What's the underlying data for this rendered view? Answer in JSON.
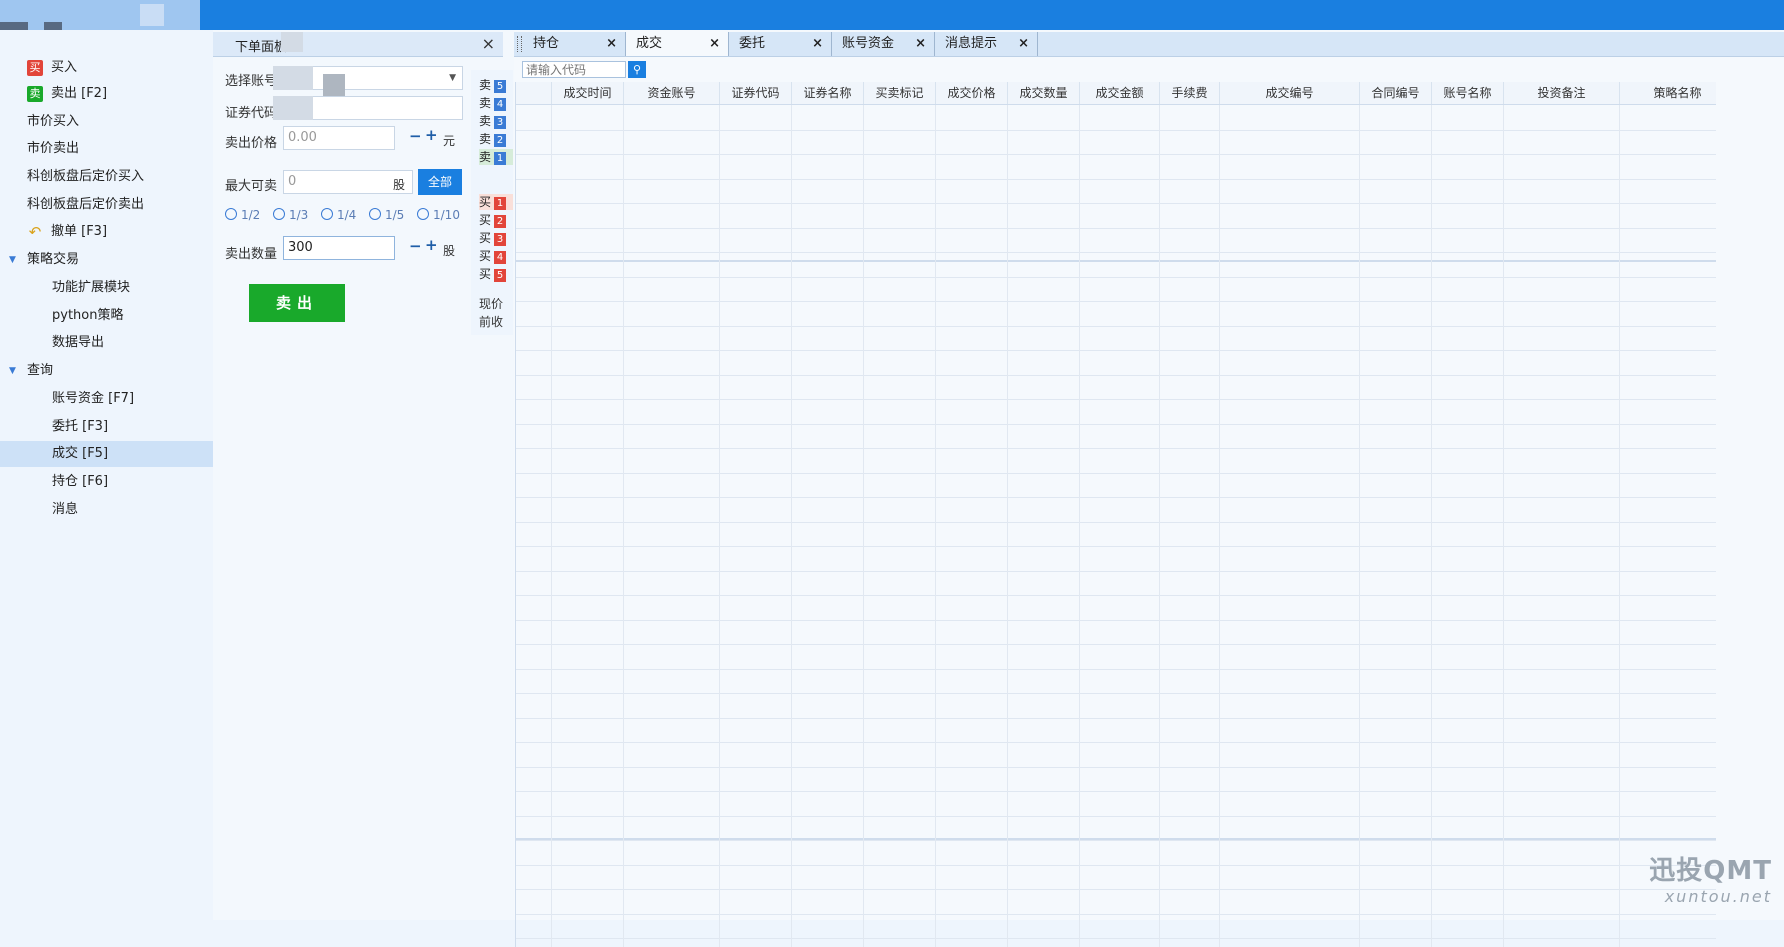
{
  "left_nav": {
    "items": [
      {
        "label": "买入",
        "icon": "buy-icon"
      },
      {
        "label": "卖出 [F2]",
        "icon": "sell-icon"
      },
      {
        "label": "市价买入"
      },
      {
        "label": "市价卖出"
      },
      {
        "label": "科创板盘后定价买入"
      },
      {
        "label": "科创板盘后定价卖出"
      },
      {
        "label": "撤单 [F3]",
        "icon": "undo-icon"
      },
      {
        "label": "策略交易",
        "group": true
      },
      {
        "label": "功能扩展模块"
      },
      {
        "label": "python策略"
      },
      {
        "label": "数据导出"
      },
      {
        "label": "查询",
        "group": true
      },
      {
        "label": "账号资金 [F7]"
      },
      {
        "label": "委托 [F3]"
      },
      {
        "label": "成交 [F5]",
        "selected": true
      },
      {
        "label": "持仓 [F6]"
      },
      {
        "label": "消息"
      }
    ],
    "sell_icon_text": "卖"
  },
  "order_panel": {
    "tab_title": "下单面板",
    "close": "×",
    "select_account_label": "选择账号",
    "security_code_label": "证券代码",
    "sell_price_label": "卖出价格",
    "sell_price_value": "0.00",
    "price_unit": "元",
    "max_sellable_label": "最大可卖",
    "max_sellable_value": "0",
    "shares_unit": "股",
    "all_button": "全部",
    "ratios": [
      "1/2",
      "1/3",
      "1/4",
      "1/5",
      "1/10"
    ],
    "sell_qty_label": "卖出数量",
    "sell_qty_value": "300",
    "minus": "−",
    "plus": "+",
    "sell_button": "卖出"
  },
  "depth": {
    "sell": [
      {
        "label": "卖",
        "num": "5"
      },
      {
        "label": "卖",
        "num": "4"
      },
      {
        "label": "卖",
        "num": "3"
      },
      {
        "label": "卖",
        "num": "2"
      },
      {
        "label": "卖",
        "num": "1"
      }
    ],
    "buy": [
      {
        "label": "买",
        "num": "1"
      },
      {
        "label": "买",
        "num": "2"
      },
      {
        "label": "买",
        "num": "3"
      },
      {
        "label": "买",
        "num": "4"
      },
      {
        "label": "买",
        "num": "5"
      }
    ],
    "current_price": "现价",
    "prev_close": "前收"
  },
  "tabs": [
    {
      "label": "持仓",
      "close": "×"
    },
    {
      "label": "成交",
      "close": "×",
      "active": true
    },
    {
      "label": "委托",
      "close": "×"
    },
    {
      "label": "账号资金",
      "close": "×"
    },
    {
      "label": "消息提示",
      "close": "×"
    }
  ],
  "search": {
    "placeholder": "请输入代码"
  },
  "table": {
    "columns": [
      "成交时间",
      "资金账号",
      "证券代码",
      "证券名称",
      "买卖标记",
      "成交价格",
      "成交数量",
      "成交金额",
      "手续费",
      "成交编号",
      "合同编号",
      "账号名称",
      "投资备注",
      "策略名称"
    ]
  },
  "watermark": {
    "line1": "迅投QMT",
    "line2": "xuntou.net"
  },
  "colors": {
    "accent": "#1a7fe0",
    "sell_green": "#19a92b",
    "buy_red": "#e2453a"
  }
}
